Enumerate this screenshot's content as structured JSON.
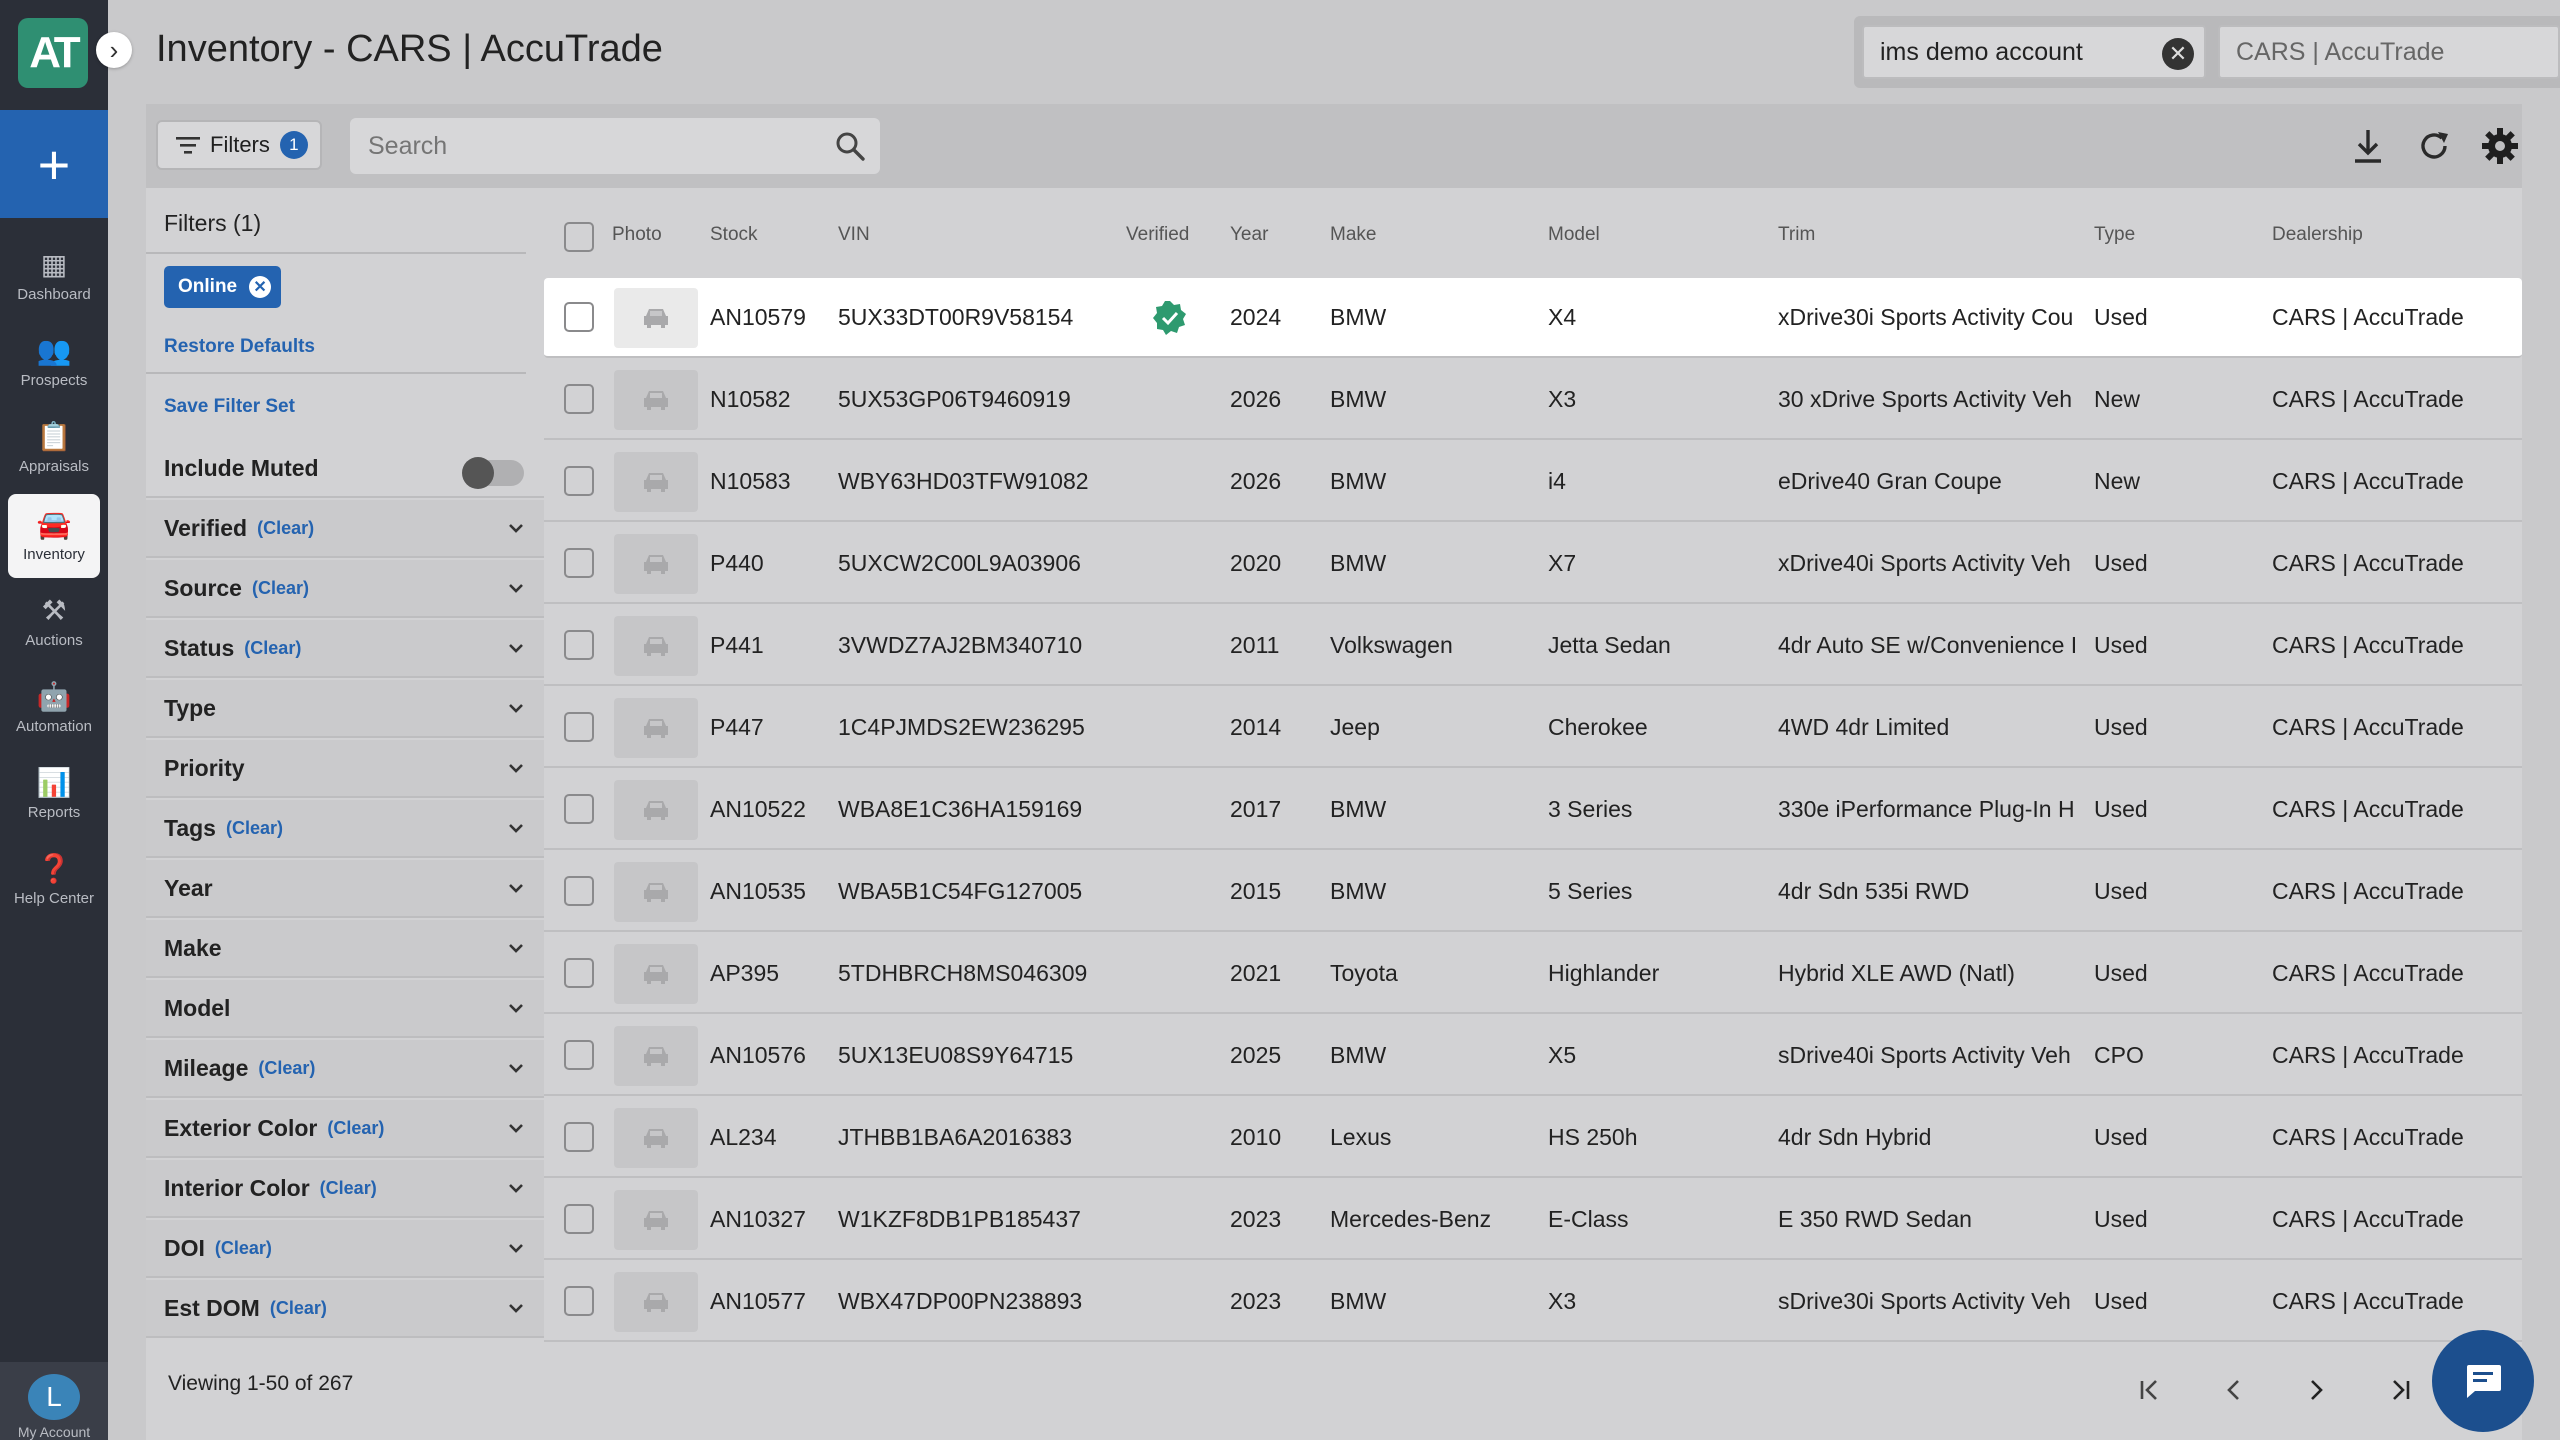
{
  "app": {
    "logo_text": "AT",
    "page_title": "Inventory - CARS | AccuTrade",
    "account_value": "ims demo account",
    "dealership_placeholder": "CARS | AccuTrade",
    "help_label": "?"
  },
  "nav": {
    "items": [
      {
        "label": "Dashboard",
        "icon": "dashboard-icon",
        "glyph": "▦"
      },
      {
        "label": "Prospects",
        "icon": "people-icon",
        "glyph": "👥"
      },
      {
        "label": "Appraisals",
        "icon": "clipboard-icon",
        "glyph": "📋"
      },
      {
        "label": "Inventory",
        "icon": "car-icon",
        "glyph": "🚘"
      },
      {
        "label": "Auctions",
        "icon": "gavel-icon",
        "glyph": "⚒"
      },
      {
        "label": "Automation",
        "icon": "robot-icon",
        "glyph": "🤖"
      },
      {
        "label": "Reports",
        "icon": "bar-chart-icon",
        "glyph": "📊"
      },
      {
        "label": "Help Center",
        "icon": "help-icon",
        "glyph": "❓"
      }
    ],
    "active": "Inventory",
    "account_initial": "L",
    "account_label": "My Account"
  },
  "toolbar": {
    "filters_label": "Filters",
    "filters_count": "1",
    "search_placeholder": "Search"
  },
  "filters": {
    "heading": "Filters (1)",
    "chip": "Online",
    "restore_defaults": "Restore Defaults",
    "save_filter_set": "Save Filter Set",
    "include_muted": "Include Muted",
    "clear_label": "(Clear)",
    "groups": [
      {
        "label": "Verified",
        "clear": true
      },
      {
        "label": "Source",
        "clear": true
      },
      {
        "label": "Status",
        "clear": true
      },
      {
        "label": "Type",
        "clear": false
      },
      {
        "label": "Priority",
        "clear": false
      },
      {
        "label": "Tags",
        "clear": true
      },
      {
        "label": "Year",
        "clear": false
      },
      {
        "label": "Make",
        "clear": false
      },
      {
        "label": "Model",
        "clear": false
      },
      {
        "label": "Mileage",
        "clear": true
      },
      {
        "label": "Exterior Color",
        "clear": true
      },
      {
        "label": "Interior Color",
        "clear": true
      },
      {
        "label": "DOI",
        "clear": true
      },
      {
        "label": "Est DOM",
        "clear": true
      }
    ]
  },
  "table": {
    "columns": [
      "Photo",
      "Stock",
      "VIN",
      "Verified",
      "Year",
      "Make",
      "Model",
      "Trim",
      "Type",
      "Dealership"
    ],
    "rows": [
      {
        "stock": "AN10579",
        "vin": "5UX33DT00R9V58154",
        "verified": true,
        "year": "2024",
        "make": "BMW",
        "model": "X4",
        "trim": "xDrive30i Sports Activity Cou",
        "type": "Used",
        "dealership": "CARS | AccuTrade"
      },
      {
        "stock": "N10582",
        "vin": "5UX53GP06T9460919",
        "verified": false,
        "year": "2026",
        "make": "BMW",
        "model": "X3",
        "trim": "30 xDrive Sports Activity Veh",
        "type": "New",
        "dealership": "CARS | AccuTrade"
      },
      {
        "stock": "N10583",
        "vin": "WBY63HD03TFW91082",
        "verified": false,
        "year": "2026",
        "make": "BMW",
        "model": "i4",
        "trim": "eDrive40 Gran Coupe",
        "type": "New",
        "dealership": "CARS | AccuTrade"
      },
      {
        "stock": "P440",
        "vin": "5UXCW2C00L9A03906",
        "verified": false,
        "year": "2020",
        "make": "BMW",
        "model": "X7",
        "trim": "xDrive40i Sports Activity Veh",
        "type": "Used",
        "dealership": "CARS | AccuTrade"
      },
      {
        "stock": "P441",
        "vin": "3VWDZ7AJ2BM340710",
        "verified": false,
        "year": "2011",
        "make": "Volkswagen",
        "model": "Jetta Sedan",
        "trim": "4dr Auto SE w/Convenience I",
        "type": "Used",
        "dealership": "CARS | AccuTrade"
      },
      {
        "stock": "P447",
        "vin": "1C4PJMDS2EW236295",
        "verified": false,
        "year": "2014",
        "make": "Jeep",
        "model": "Cherokee",
        "trim": "4WD 4dr Limited",
        "type": "Used",
        "dealership": "CARS | AccuTrade"
      },
      {
        "stock": "AN10522",
        "vin": "WBA8E1C36HA159169",
        "verified": false,
        "year": "2017",
        "make": "BMW",
        "model": "3 Series",
        "trim": "330e iPerformance Plug-In H",
        "type": "Used",
        "dealership": "CARS | AccuTrade"
      },
      {
        "stock": "AN10535",
        "vin": "WBA5B1C54FG127005",
        "verified": false,
        "year": "2015",
        "make": "BMW",
        "model": "5 Series",
        "trim": "4dr Sdn 535i RWD",
        "type": "Used",
        "dealership": "CARS | AccuTrade"
      },
      {
        "stock": "AP395",
        "vin": "5TDHBRCH8MS046309",
        "verified": false,
        "year": "2021",
        "make": "Toyota",
        "model": "Highlander",
        "trim": "Hybrid XLE AWD (Natl)",
        "type": "Used",
        "dealership": "CARS | AccuTrade"
      },
      {
        "stock": "AN10576",
        "vin": "5UX13EU08S9Y64715",
        "verified": false,
        "year": "2025",
        "make": "BMW",
        "model": "X5",
        "trim": "sDrive40i Sports Activity Veh",
        "type": "CPO",
        "dealership": "CARS | AccuTrade"
      },
      {
        "stock": "AL234",
        "vin": "JTHBB1BA6A2016383",
        "verified": false,
        "year": "2010",
        "make": "Lexus",
        "model": "HS 250h",
        "trim": "4dr Sdn Hybrid",
        "type": "Used",
        "dealership": "CARS | AccuTrade"
      },
      {
        "stock": "AN10327",
        "vin": "W1KZF8DB1PB185437",
        "verified": false,
        "year": "2023",
        "make": "Mercedes-Benz",
        "model": "E-Class",
        "trim": "E 350 RWD Sedan",
        "type": "Used",
        "dealership": "CARS | AccuTrade"
      },
      {
        "stock": "AN10577",
        "vin": "WBX47DP00PN238893",
        "verified": false,
        "year": "2023",
        "make": "BMW",
        "model": "X3",
        "trim": "sDrive30i Sports Activity Veh",
        "type": "Used",
        "dealership": "CARS | AccuTrade"
      }
    ]
  },
  "footer": {
    "viewing": "Viewing 1-50 of 267"
  },
  "colors": {
    "accent": "#2463b0",
    "brand_green": "#2f8f72",
    "rail": "#2b2f38",
    "verified_green": "#2e9a6f"
  }
}
